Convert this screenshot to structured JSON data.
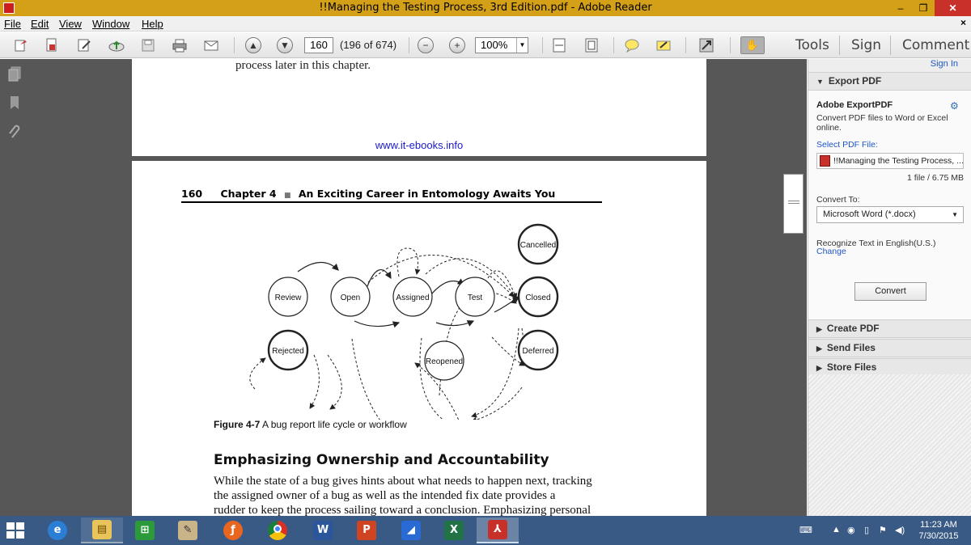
{
  "window": {
    "title": "!!Managing the Testing Process, 3rd Edition.pdf - Adobe Reader",
    "min_glyph": "–",
    "max_glyph": "❐",
    "close_glyph": "✕",
    "doc_close_glyph": "×"
  },
  "menu": [
    "File",
    "Edit",
    "View",
    "Window",
    "Help"
  ],
  "toolbar": {
    "page_number": "160",
    "page_count": "(196 of 674)",
    "zoom": "100%",
    "right_tabs": [
      "Tools",
      "Sign",
      "Comment"
    ]
  },
  "document": {
    "top_line": "process later in this chapter.",
    "url": "www.it-ebooks.info",
    "running_head": {
      "page": "160",
      "chapter": "Chapter 4",
      "separator": "■",
      "title": "An Exciting Career in Entomology Awaits You"
    },
    "diagram": {
      "nodes": [
        {
          "label": "Review",
          "bold": false
        },
        {
          "label": "Open",
          "bold": false
        },
        {
          "label": "Assigned",
          "bold": false
        },
        {
          "label": "Test",
          "bold": false
        },
        {
          "label": "Closed",
          "bold": true
        },
        {
          "label": "Cancelled",
          "bold": true
        },
        {
          "label": "Rejected",
          "bold": true
        },
        {
          "label": "Reopened",
          "bold": false
        },
        {
          "label": "Deferred",
          "bold": true
        }
      ]
    },
    "figure_label": "Figure 4-7",
    "figure_caption": "A bug report life cycle or workflow",
    "section_title": "Emphasizing Ownership and Accountability",
    "body_lines": [
      "While the state of a bug gives hints about what needs to happen next, tracking",
      "the assigned owner of a bug as well as the intended fix date provides a",
      "rudder to keep the process sailing toward a conclusion. Emphasizing personal"
    ]
  },
  "right_panel": {
    "sign_in": "Sign In",
    "sections": {
      "export": "Export PDF",
      "create": "Create PDF",
      "send": "Send Files",
      "store": "Store Files"
    },
    "export_title": "Adobe ExportPDF",
    "export_desc": "Convert PDF files to Word or Excel online.",
    "select_label": "Select PDF File:",
    "selected_file": "!!Managing the Testing Process, ...",
    "file_info": "1 file / 6.75 MB",
    "convert_to_label": "Convert To:",
    "convert_to_value": "Microsoft Word (*.docx)",
    "recognize_text": "Recognize Text in English(U.S.)",
    "change_link": "Change",
    "convert_button": "Convert"
  },
  "taskbar": {
    "time": "11:23 AM",
    "date": "7/30/2015"
  },
  "colors": {
    "title_bar": "#d4a017",
    "close_button": "#c8302a",
    "doc_background": "#575757",
    "link": "#1f55c5",
    "url_text": "#1a1acc",
    "taskbar": "#3a5a86"
  }
}
